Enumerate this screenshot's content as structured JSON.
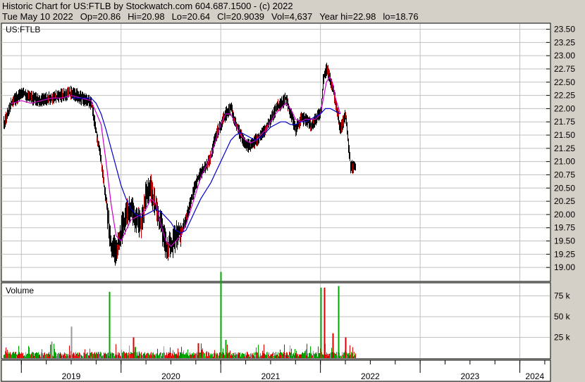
{
  "header": {
    "title": "Historic Chart for US:FTLB by Stockwatch.com 604.687.1500 - (c) 2022",
    "date": "Tue May 10 2022",
    "open": "Op=20.86",
    "high": "Hi=20.98",
    "low": "Lo=20.64",
    "close": "Cl=20.9039",
    "volume": "Vol=4,637",
    "year_high": "Year hi=22.98",
    "year_low": "lo=18.76"
  },
  "colors": {
    "background": "#d4d0c8",
    "panel": "#ffffff",
    "price_bar": "#000000",
    "down_bar": "#cc0000",
    "ma_short": "#cc00cc",
    "ma_long": "#0000cc",
    "volume_up": "#00aa00",
    "volume_down": "#dd0000",
    "volume_neutral": "#999999",
    "grid": "#c0c0c0"
  },
  "chart_data": [
    {
      "type": "line",
      "title": "US:FTLB",
      "chart_kind": "OHLC price bars with moving averages",
      "y_ticks": [
        "23.50",
        "23.25",
        "23.00",
        "22.75",
        "22.50",
        "22.25",
        "22.00",
        "21.75",
        "21.50",
        "21.25",
        "21.00",
        "20.75",
        "20.50",
        "20.25",
        "20.00",
        "19.75",
        "19.50",
        "19.25",
        "19.00"
      ],
      "ylim": [
        18.75,
        23.6
      ],
      "x_labels": [
        "2019",
        "2020",
        "2021",
        "2022",
        "2023",
        "2024"
      ],
      "x_range": [
        2018.8,
        2024.3
      ],
      "grid": true,
      "series": [
        {
          "kind": "close",
          "x": [
            2018.82,
            2018.9,
            2019.0,
            2019.1,
            2019.2,
            2019.3,
            2019.4,
            2019.5,
            2019.6,
            2019.7,
            2019.8,
            2019.85,
            2019.9,
            2019.95,
            2020.0,
            2020.05,
            2020.1,
            2020.15,
            2020.2,
            2020.25,
            2020.3,
            2020.35,
            2020.4,
            2020.45,
            2020.5,
            2020.55,
            2020.6,
            2020.65,
            2020.7,
            2020.75,
            2020.8,
            2020.85,
            2020.9,
            2020.95,
            2021.0,
            2021.05,
            2021.1,
            2021.15,
            2021.2,
            2021.25,
            2021.3,
            2021.35,
            2021.4,
            2021.45,
            2021.5,
            2021.55,
            2021.6,
            2021.65,
            2021.7,
            2021.75,
            2021.8,
            2021.85,
            2021.9,
            2021.95,
            2022.0,
            2022.03,
            2022.06,
            2022.09,
            2022.12,
            2022.15,
            2022.2,
            2022.25,
            2022.3,
            2022.35
          ],
          "values": [
            21.7,
            22.1,
            22.3,
            22.2,
            22.15,
            22.2,
            22.25,
            22.3,
            22.2,
            22.1,
            21.0,
            20.2,
            19.4,
            19.3,
            19.7,
            20.0,
            20.1,
            19.9,
            19.8,
            20.4,
            20.5,
            20.1,
            19.8,
            19.4,
            19.4,
            19.6,
            19.7,
            19.9,
            20.3,
            20.6,
            20.8,
            20.9,
            21.1,
            21.5,
            21.7,
            21.9,
            22.0,
            21.7,
            21.5,
            21.3,
            21.3,
            21.4,
            21.5,
            21.6,
            21.8,
            22.0,
            22.1,
            22.2,
            21.9,
            21.6,
            21.8,
            21.8,
            21.7,
            21.8,
            21.9,
            22.6,
            22.75,
            22.6,
            22.4,
            22.1,
            21.6,
            21.9,
            20.9,
            20.9
          ]
        },
        {
          "kind": "moving_average_short",
          "x": [
            2018.9,
            2019.0,
            2019.1,
            2019.2,
            2019.3,
            2019.4,
            2019.5,
            2019.6,
            2019.7,
            2019.8,
            2019.85,
            2019.9,
            2019.95,
            2020.0,
            2020.05,
            2020.1,
            2020.15,
            2020.2,
            2020.25,
            2020.3,
            2020.35,
            2020.4,
            2020.45,
            2020.5,
            2020.55,
            2020.6,
            2020.65,
            2020.7,
            2020.75,
            2020.8,
            2020.85,
            2020.9,
            2020.95,
            2021.0,
            2021.05,
            2021.1,
            2021.15,
            2021.2,
            2021.25,
            2021.3,
            2021.35,
            2021.4,
            2021.45,
            2021.5,
            2021.55,
            2021.6,
            2021.65,
            2021.7,
            2021.75,
            2021.8,
            2021.85,
            2021.9,
            2021.95,
            2022.0,
            2022.03,
            2022.06,
            2022.09,
            2022.12,
            2022.15,
            2022.2
          ],
          "values": [
            22.1,
            22.15,
            22.1,
            22.15,
            22.2,
            22.2,
            22.25,
            22.2,
            22.15,
            21.7,
            21.0,
            20.2,
            19.6,
            19.5,
            19.7,
            19.9,
            19.95,
            20.0,
            20.1,
            20.3,
            20.2,
            19.8,
            19.5,
            19.4,
            19.5,
            19.6,
            19.8,
            20.1,
            20.4,
            20.7,
            20.9,
            21.1,
            21.4,
            21.7,
            21.9,
            21.9,
            21.7,
            21.5,
            21.4,
            21.35,
            21.4,
            21.5,
            21.6,
            21.75,
            21.9,
            22.0,
            22.1,
            22.0,
            21.8,
            21.75,
            21.8,
            21.8,
            21.8,
            21.9,
            22.2,
            22.5,
            22.6,
            22.5,
            22.2,
            21.9
          ]
        },
        {
          "kind": "moving_average_long",
          "x": [
            2019.5,
            2019.6,
            2019.7,
            2019.75,
            2019.8,
            2019.85,
            2019.9,
            2019.95,
            2020.0,
            2020.05,
            2020.1,
            2020.15,
            2020.2,
            2020.25,
            2020.3,
            2020.35,
            2020.4,
            2020.45,
            2020.5,
            2020.55,
            2020.6,
            2020.65,
            2020.7,
            2020.75,
            2020.8,
            2020.85,
            2020.9,
            2020.95,
            2021.0,
            2021.05,
            2021.1,
            2021.15,
            2021.2,
            2021.25,
            2021.3,
            2021.35,
            2021.4,
            2021.45,
            2021.5,
            2021.55,
            2021.6,
            2021.65,
            2021.7,
            2021.75,
            2021.8,
            2021.85,
            2021.9,
            2021.95,
            2022.0,
            2022.05,
            2022.1,
            2022.15,
            2022.2
          ],
          "values": [
            22.2,
            22.2,
            22.2,
            22.1,
            21.9,
            21.6,
            21.25,
            20.9,
            20.55,
            20.3,
            20.1,
            20.0,
            19.95,
            20.0,
            20.05,
            20.1,
            20.05,
            19.95,
            19.85,
            19.7,
            19.65,
            19.7,
            19.9,
            20.1,
            20.3,
            20.45,
            20.6,
            20.8,
            21.0,
            21.2,
            21.4,
            21.5,
            21.55,
            21.5,
            21.45,
            21.4,
            21.45,
            21.55,
            21.65,
            21.7,
            21.75,
            21.75,
            21.7,
            21.7,
            21.75,
            21.75,
            21.8,
            21.85,
            21.9,
            22.0,
            22.0,
            21.95,
            21.9
          ]
        }
      ]
    },
    {
      "type": "bar",
      "title": "Volume",
      "y_ticks": [
        "75 k",
        "50 k",
        "25 k"
      ],
      "ylim": [
        0,
        90000
      ],
      "x_range": [
        2018.8,
        2024.3
      ],
      "highlights": [
        {
          "x": 2019.3,
          "value": 20000,
          "kind": "neutral"
        },
        {
          "x": 2019.5,
          "value": 38000,
          "kind": "neutral"
        },
        {
          "x": 2019.88,
          "value": 80000,
          "kind": "up"
        },
        {
          "x": 2020.12,
          "value": 25000,
          "kind": "down"
        },
        {
          "x": 2020.77,
          "value": 18000,
          "kind": "down"
        },
        {
          "x": 2021.0,
          "value": 104000,
          "kind": "up"
        },
        {
          "x": 2021.05,
          "value": 22000,
          "kind": "up"
        },
        {
          "x": 2022.0,
          "value": 85000,
          "kind": "up"
        },
        {
          "x": 2022.04,
          "value": 85000,
          "kind": "down"
        },
        {
          "x": 2022.12,
          "value": 30000,
          "kind": "down"
        },
        {
          "x": 2022.18,
          "value": 87000,
          "kind": "up"
        },
        {
          "x": 2022.25,
          "value": 25000,
          "kind": "down"
        }
      ]
    }
  ]
}
